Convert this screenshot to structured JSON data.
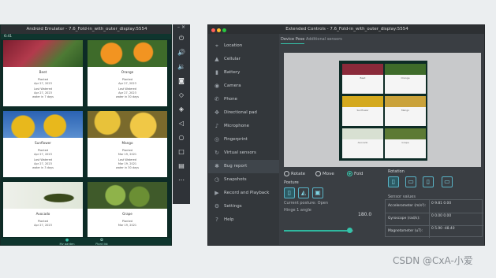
{
  "emulator": {
    "title": "Android Emulator - 7.6_Fold-in_with_outer_display:5554",
    "status_time": "6:41",
    "cards": [
      {
        "name": "Beet",
        "lines": [
          "Planted",
          "Apr 27, 2023",
          "Last Watered",
          "Apr 27, 2023",
          "water in 7 days"
        ]
      },
      {
        "name": "Orange",
        "lines": [
          "Planted",
          "Apr 27, 2023",
          "Last Watered",
          "Apr 27, 2023",
          "water in 30 days"
        ]
      },
      {
        "name": "Sunflower",
        "lines": [
          "Planted",
          "Apr 27, 2023",
          "Last Watered",
          "Apr 27, 2023",
          "water in 3 days"
        ]
      },
      {
        "name": "Mango",
        "lines": [
          "Planted",
          "Mar 19, 2021",
          "Last Watered",
          "Mar 19, 2021",
          "water in 30 days"
        ]
      },
      {
        "name": "Avocado",
        "lines": [
          "Planted",
          "Apr 27, 2023"
        ]
      },
      {
        "name": "Grape",
        "lines": [
          "Planted",
          "Mar 19, 2021"
        ]
      }
    ],
    "nav": [
      "My garden",
      "Plant list"
    ]
  },
  "toolbar": {
    "icons": [
      "power-icon",
      "volume-up-icon",
      "volume-down-icon",
      "rotate-left-icon",
      "rotate-right-icon",
      "camera-icon",
      "zoom-icon",
      "back-icon",
      "home-icon",
      "overview-icon",
      "fold-icon",
      "more-icon"
    ]
  },
  "extended": {
    "title": "Extended Controls - 7.6_Fold-in_with_outer_display:5554",
    "menu": [
      {
        "label": "Location",
        "icon": "location-icon"
      },
      {
        "label": "Cellular",
        "icon": "cellular-icon"
      },
      {
        "label": "Battery",
        "icon": "battery-icon"
      },
      {
        "label": "Camera",
        "icon": "camera-icon"
      },
      {
        "label": "Phone",
        "icon": "phone-icon"
      },
      {
        "label": "Directional pad",
        "icon": "dpad-icon"
      },
      {
        "label": "Microphone",
        "icon": "microphone-icon"
      },
      {
        "label": "Fingerprint",
        "icon": "fingerprint-icon"
      },
      {
        "label": "Virtual sensors",
        "icon": "sensor-icon"
      },
      {
        "label": "Bug report",
        "icon": "bug-icon"
      },
      {
        "label": "Snapshots",
        "icon": "snapshot-icon"
      },
      {
        "label": "Record and Playback",
        "icon": "record-icon"
      },
      {
        "label": "Settings",
        "icon": "settings-icon"
      },
      {
        "label": "Help",
        "icon": "help-icon"
      }
    ],
    "tabs": [
      "Device Pose",
      "Additional sensors"
    ],
    "pose_modes": [
      "Rotate",
      "Move",
      "Fold"
    ],
    "posture_label": "Posture",
    "posture_value": "Current posture: Open",
    "hinge_label": "Hinge 1 angle",
    "hinge_value": "180.0",
    "rotation_label": "Rotation",
    "sensor_label": "Sensor values",
    "sensors": [
      {
        "name": "Accelerometer (m/s²):",
        "values": "0    9.81    0.00"
      },
      {
        "name": "Gyroscope (rad/s):",
        "values": "0    0.00    0.00"
      },
      {
        "name": "Magnetometer (uT):",
        "values": "0    5.90  -48.40"
      }
    ],
    "accent": "#35c3aa"
  },
  "watermark": "CSDN @CxA-小爱"
}
